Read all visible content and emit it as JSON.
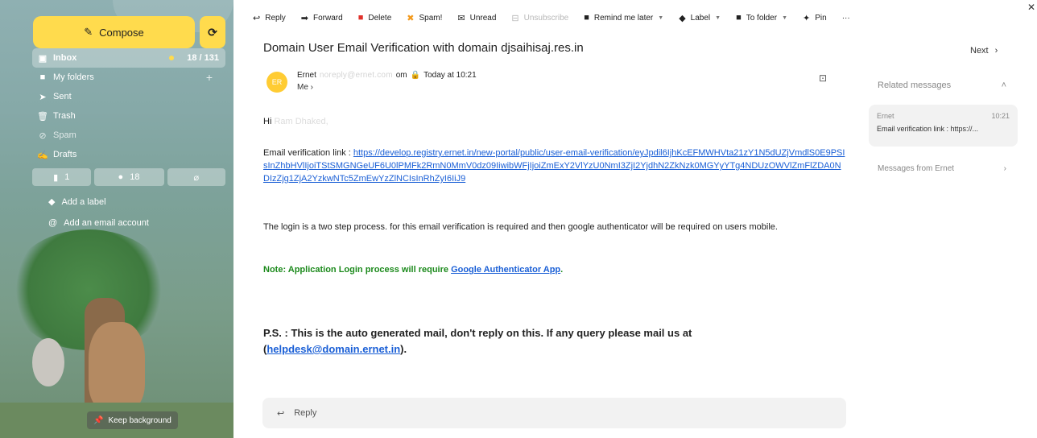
{
  "sidebar": {
    "compose_label": "Compose",
    "refresh_icon": "refresh-icon",
    "folders": [
      {
        "label": "Inbox",
        "count": "18 / 131"
      },
      {
        "label": "My folders"
      },
      {
        "label": "Sent"
      },
      {
        "label": "Trash"
      },
      {
        "label": "Spam"
      },
      {
        "label": "Drafts"
      }
    ],
    "filters": {
      "flagged": "1",
      "unread": "18"
    },
    "add_label": "Add a label",
    "add_account": "Add an email account",
    "keep_background": "Keep background"
  },
  "toolbar": {
    "reply": "Reply",
    "forward": "Forward",
    "delete": "Delete",
    "spam": "Spam!",
    "unread": "Unread",
    "unsubscribe": "Unsubscribe",
    "remind": "Remind me later",
    "label": "Label",
    "to_folder": "To folder",
    "pin": "Pin",
    "more": "···"
  },
  "message": {
    "subject": "Domain User Email Verification with domain djsaihisaj.res.in",
    "avatar_initials": "ER",
    "sender_name": "Ernet",
    "sender_email_blurred": "noreply@ernet.com",
    "sender_email_tail": "om",
    "time": "Today at 10:21",
    "recipient": "Me ›",
    "greeting": "Hi",
    "greeting_name_blurred": "Ram Dhaked,",
    "verification_prefix": "Email verification link : ",
    "verification_link": "https://develop.registry.ernet.in/new-portal/public/user-email-verification/eyJpdil6IjhKcEFMWHVta21zY1N5dUZjVmdlS0E9PSIsInZhbHVlIjoiTStSMGNGeUF6U0lPMFk2RmN0MmV0dz09IiwibWFjIjoiZmExY2VlYzU0NmI3ZjI2YjdhN2ZkNzk0MGYyYTg4NDUzOWVlZmFlZDA0NDIzZjg1ZjA2YzkwNTc5ZmEwYzZlNCIsInRhZyI6IiJ9",
    "para": "The login is a two step process. for this email verification is required and then google authenticator will be required on users mobile.",
    "note_prefix": "Note: Application Login process will require ",
    "note_link": "Google Authenticator App",
    "note_suffix": ".",
    "ps_prefix": "P.S. : This is the auto generated mail, don't reply on this. If any query please mail us at (",
    "ps_link": "helpdesk@domain.ernet.in",
    "ps_suffix": ").",
    "reply_label": "Reply"
  },
  "right_panel": {
    "next": "Next",
    "related_header": "Related messages",
    "related": {
      "sender": "Ernet",
      "time": "10:21",
      "snippet": "Email verification link : https://..."
    },
    "messages_from": "Messages from Ernet"
  },
  "colors": {
    "compose": "#ffdb4d",
    "link": "#1a5fd6",
    "note": "#1c8a1c",
    "avatar": "#ffcc33"
  }
}
